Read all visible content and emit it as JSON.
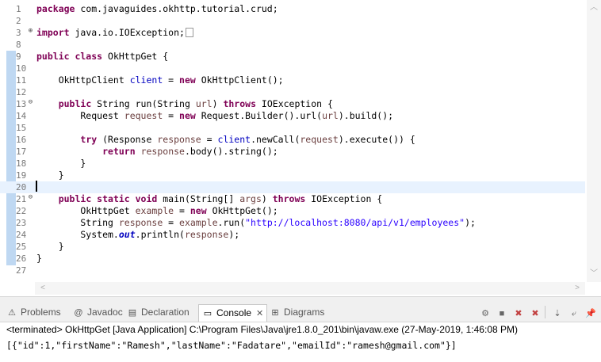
{
  "editor": {
    "lines": [
      {
        "n": "1",
        "html": "<span class=\"kw\">package</span> com.javaguides.okhttp.tutorial.crud;"
      },
      {
        "n": "2",
        "html": ""
      },
      {
        "n": "3",
        "fold": "⊕",
        "html": "<span class=\"kw\">import</span> java.io.IOException;<span class=\"collapsed-box\"></span>"
      },
      {
        "n": "8",
        "html": ""
      },
      {
        "n": "9",
        "html": "<span class=\"kw\">public class</span> OkHttpGet {"
      },
      {
        "n": "10",
        "html": ""
      },
      {
        "n": "11",
        "html": "    OkHttpClient <span class=\"fld\">client</span> = <span class=\"kw\">new</span> OkHttpClient();"
      },
      {
        "n": "12",
        "html": ""
      },
      {
        "n": "13",
        "fold": "⊖",
        "html": "    <span class=\"kw\">public</span> String run(String <span class=\"var\">url</span>) <span class=\"kw\">throws</span> IOException {"
      },
      {
        "n": "14",
        "html": "        Request <span class=\"var\">request</span> = <span class=\"kw\">new</span> Request.Builder().url(<span class=\"var\">url</span>).build();"
      },
      {
        "n": "15",
        "html": ""
      },
      {
        "n": "16",
        "html": "        <span class=\"kw\">try</span> (Response <span class=\"var\">response</span> = <span class=\"fld\">client</span>.newCall(<span class=\"var\">request</span>).execute()) {"
      },
      {
        "n": "17",
        "html": "            <span class=\"kw\">return</span> <span class=\"var\">response</span>.body().string();"
      },
      {
        "n": "18",
        "html": "        }"
      },
      {
        "n": "19",
        "html": "    }"
      },
      {
        "n": "20",
        "current": true,
        "html": ""
      },
      {
        "n": "21",
        "fold": "⊖",
        "html": "    <span class=\"kw\">public static void</span> main(String[] <span class=\"var\">args</span>) <span class=\"kw\">throws</span> IOException {"
      },
      {
        "n": "22",
        "html": "        OkHttpGet <span class=\"var\">example</span> = <span class=\"kw\">new</span> OkHttpGet();"
      },
      {
        "n": "23",
        "html": "        String <span class=\"var\">response</span> = <span class=\"var\">example</span>.run(<span class=\"str\">\"http://localhost:8080/api/v1/employees\"</span>);"
      },
      {
        "n": "24",
        "html": "        System.<span class=\"static-fld\">out</span>.println(<span class=\"var\">response</span>);"
      },
      {
        "n": "25",
        "html": "    }"
      },
      {
        "n": "26",
        "html": "}"
      },
      {
        "n": "27",
        "html": ""
      }
    ]
  },
  "views": {
    "tabs": [
      {
        "label": "Problems",
        "icon": "problems-icon",
        "glyph": "⚠"
      },
      {
        "label": "Javadoc",
        "icon": "javadoc-icon",
        "glyph": "@"
      },
      {
        "label": "Declaration",
        "icon": "declaration-icon",
        "glyph": "▤"
      },
      {
        "label": "Console",
        "icon": "console-icon",
        "glyph": "▭",
        "active": true
      },
      {
        "label": "Diagrams",
        "icon": "diagrams-icon",
        "glyph": "⊞"
      }
    ],
    "close_glyph": "✕"
  },
  "console": {
    "terminated": "<terminated> OkHttpGet [Java Application] C:\\Program Files\\Java\\jre1.8.0_201\\bin\\javaw.exe (27-May-2019, 1:46:08 PM)",
    "output": "[{\"id\":1,\"firstName\":\"Ramesh\",\"lastName\":\"Fadatare\",\"emailId\":\"ramesh@gmail.com\"}]"
  },
  "toolbar": [
    {
      "icon": "debug-icon",
      "glyph": "⚙"
    },
    {
      "icon": "terminate-icon",
      "glyph": "■"
    },
    {
      "icon": "remove-launch-icon",
      "glyph": "✖",
      "red": true
    },
    {
      "icon": "remove-all-terminated-icon",
      "glyph": "✖",
      "red": true
    },
    {
      "sep": true
    },
    {
      "icon": "scroll-lock-icon",
      "glyph": "⇣"
    },
    {
      "icon": "word-wrap-icon",
      "glyph": "⤶"
    },
    {
      "icon": "pin-console-icon",
      "glyph": "📌"
    }
  ],
  "colors": {
    "keyword": "#7f0055",
    "field": "#0000c0",
    "string": "#2a00ff",
    "current_line": "#e8f2fe"
  }
}
